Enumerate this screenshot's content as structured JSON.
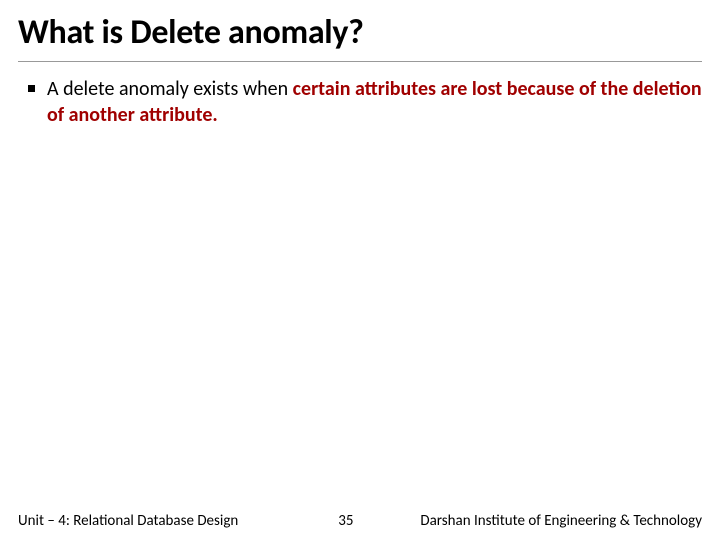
{
  "title": "What is Delete anomaly?",
  "bullet": {
    "prefix": "A delete anomaly exists when ",
    "emphasis": "certain attributes are lost because of the deletion of another attribute.",
    "suffix": ""
  },
  "footer": {
    "left": "Unit – 4: Relational Database Design",
    "page": "35",
    "right": "Darshan Institute of Engineering & Technology"
  }
}
